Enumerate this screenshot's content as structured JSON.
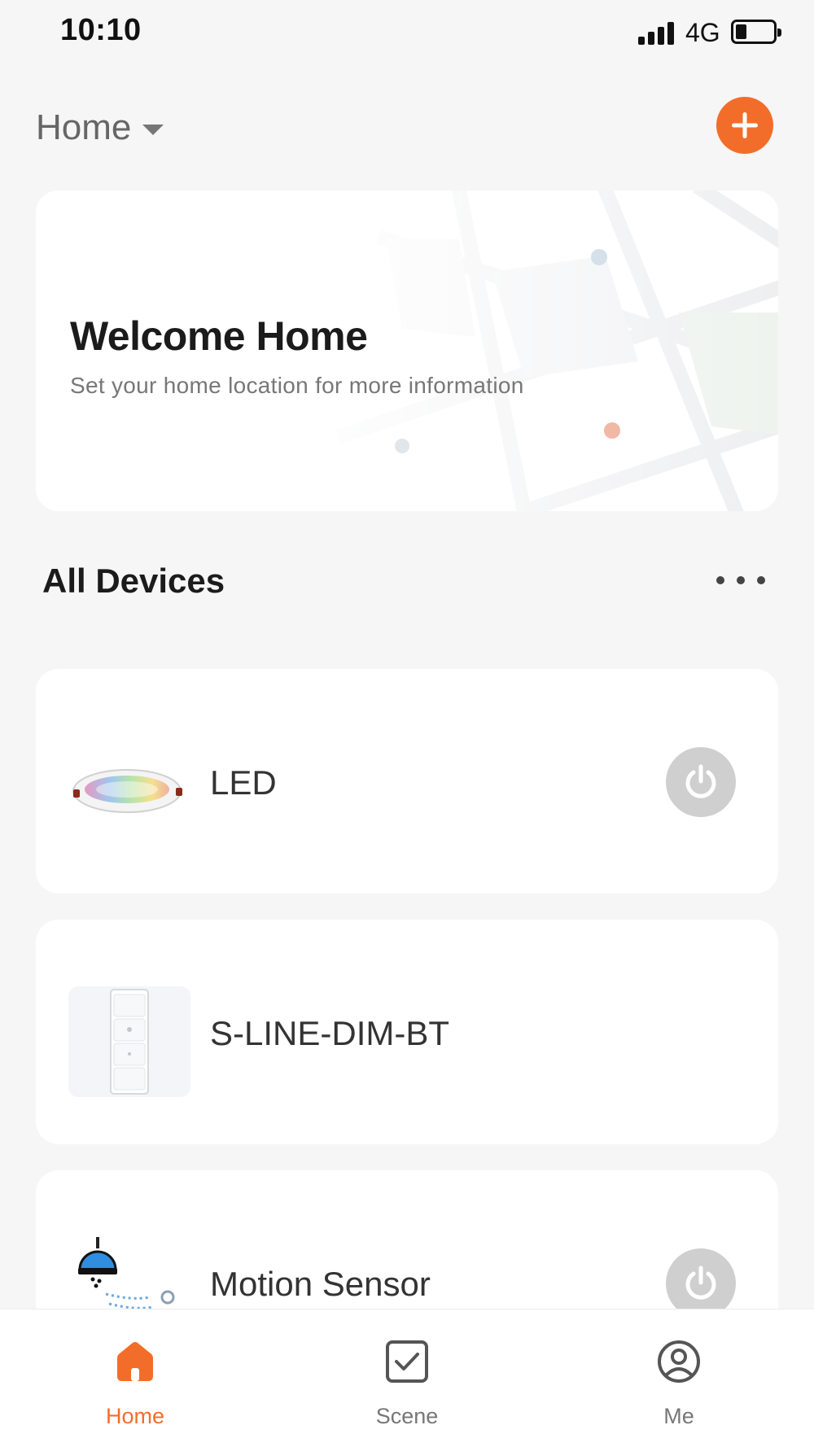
{
  "status_bar": {
    "time": "10:10",
    "network": "4G",
    "battery_level": 0.3
  },
  "header": {
    "home_label": "Home",
    "add_icon": "plus-icon"
  },
  "welcome_card": {
    "title": "Welcome Home",
    "subtitle": "Set your home location for more information"
  },
  "devices_section": {
    "title": "All Devices"
  },
  "devices": [
    {
      "name": "LED",
      "has_power_toggle": true,
      "power_on": false
    },
    {
      "name": "S-LINE-DIM-BT",
      "has_power_toggle": false
    },
    {
      "name": "Motion Sensor",
      "has_power_toggle": true,
      "power_on": false
    }
  ],
  "tab_bar": {
    "tabs": [
      {
        "label": "Home",
        "icon": "home-icon",
        "active": true
      },
      {
        "label": "Scene",
        "icon": "scene-checkbox-icon",
        "active": false
      },
      {
        "label": "Me",
        "icon": "profile-icon",
        "active": false
      }
    ]
  },
  "colors": {
    "accent": "#f36d2a",
    "background": "#f6f6f6",
    "card": "#ffffff",
    "power_off": "#cfcfcf"
  }
}
